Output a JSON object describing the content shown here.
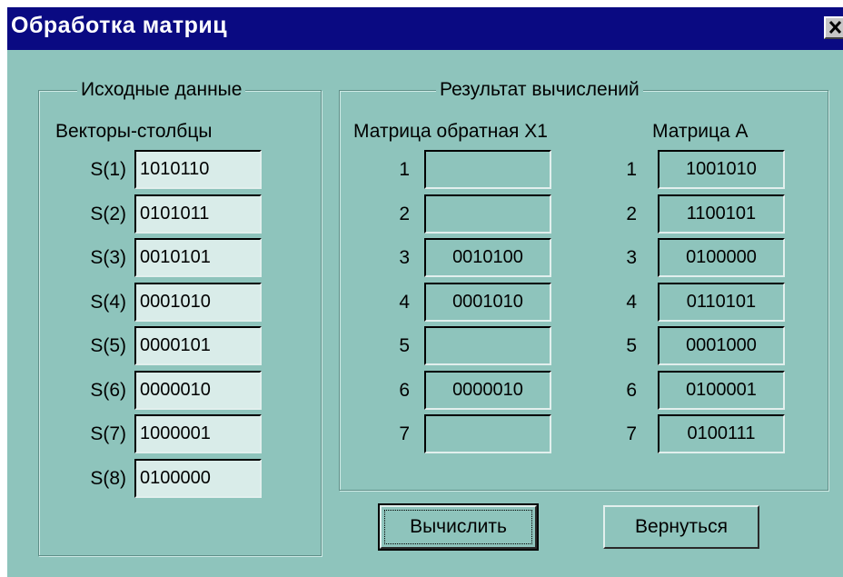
{
  "window": {
    "title": "Обработка матриц",
    "close_glyph": "✕"
  },
  "source": {
    "caption": "Исходные данные",
    "subtitle": "Векторы-столбцы",
    "rows": [
      {
        "label": "S(1)",
        "value": "1010110"
      },
      {
        "label": "S(2)",
        "value": "0101011"
      },
      {
        "label": "S(3)",
        "value": "0010101"
      },
      {
        "label": "S(4)",
        "value": "0001010"
      },
      {
        "label": "S(5)",
        "value": "0000101"
      },
      {
        "label": "S(6)",
        "value": "0000010"
      },
      {
        "label": "S(7)",
        "value": "1000001"
      },
      {
        "label": "S(8)",
        "value": "0100000"
      }
    ]
  },
  "result": {
    "caption": "Результат вычислений",
    "inverse_title": "Матрица обратная X1",
    "matrix_a_title": "Матрица A",
    "inverse_rows": [
      {
        "label": "1",
        "value": ""
      },
      {
        "label": "2",
        "value": ""
      },
      {
        "label": "3",
        "value": "0010100"
      },
      {
        "label": "4",
        "value": "0001010"
      },
      {
        "label": "5",
        "value": ""
      },
      {
        "label": "6",
        "value": "0000010"
      },
      {
        "label": "7",
        "value": ""
      }
    ],
    "matrix_a_rows": [
      {
        "label": "1",
        "value": "1001010"
      },
      {
        "label": "2",
        "value": "1100101"
      },
      {
        "label": "3",
        "value": "0100000"
      },
      {
        "label": "4",
        "value": "0110101"
      },
      {
        "label": "5",
        "value": "0001000"
      },
      {
        "label": "6",
        "value": "0100001"
      },
      {
        "label": "7",
        "value": "0100111"
      }
    ]
  },
  "buttons": {
    "compute_label": "Вычислить",
    "back_label": "Вернуться"
  },
  "colors": {
    "window_background": "#8ec4bc",
    "titlebar": "#0a0a82",
    "input_background": "#d9ece9"
  }
}
